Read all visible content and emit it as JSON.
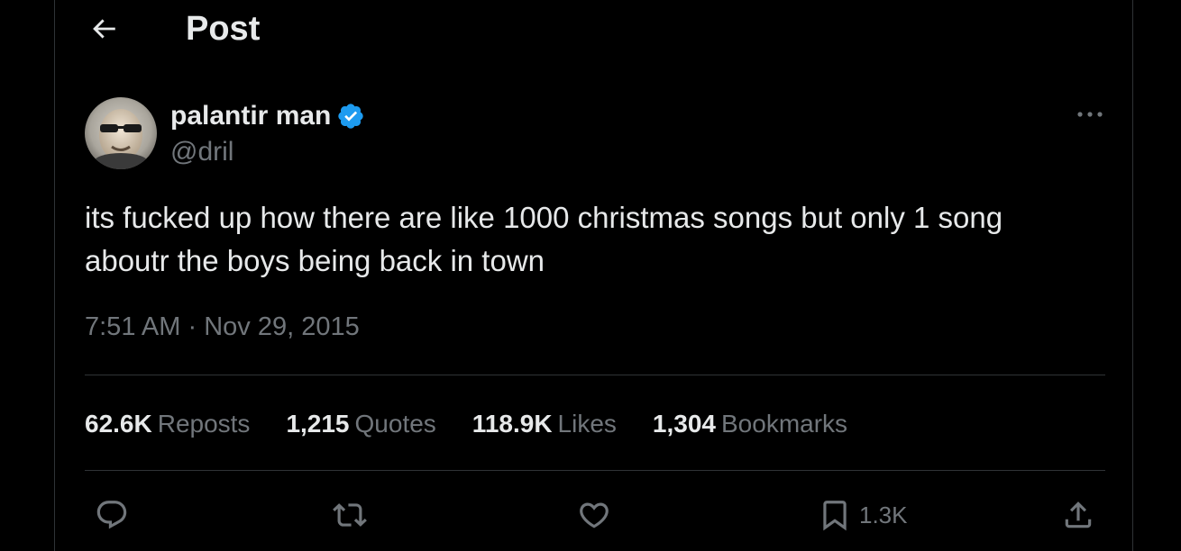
{
  "header": {
    "back_icon": "arrow-left-icon",
    "title": "Post"
  },
  "tweet": {
    "author": {
      "display_name": "palantir man",
      "handle": "@dril",
      "verified": true,
      "verified_color": "#1d9bf0"
    },
    "text": "its fucked up how there are like 1000 christmas songs but only 1 song\naboutr the boys being back in town",
    "time": "7:51 AM",
    "separator": "·",
    "date": "Nov 29, 2015"
  },
  "stats": [
    {
      "value": "62.6K",
      "label": "Reposts"
    },
    {
      "value": "1,215",
      "label": "Quotes"
    },
    {
      "value": "118.9K",
      "label": "Likes"
    },
    {
      "value": "1,304",
      "label": "Bookmarks"
    }
  ],
  "actions": {
    "reply_icon": "reply-icon",
    "repost_icon": "repost-icon",
    "like_icon": "heart-icon",
    "bookmark_icon": "bookmark-icon",
    "bookmark_count": "1.3K",
    "share_icon": "share-icon"
  },
  "colors": {
    "background": "#000000",
    "text_primary": "#e7e9ea",
    "text_secondary": "#71767b",
    "border": "#2f3336",
    "accent": "#1d9bf0"
  }
}
